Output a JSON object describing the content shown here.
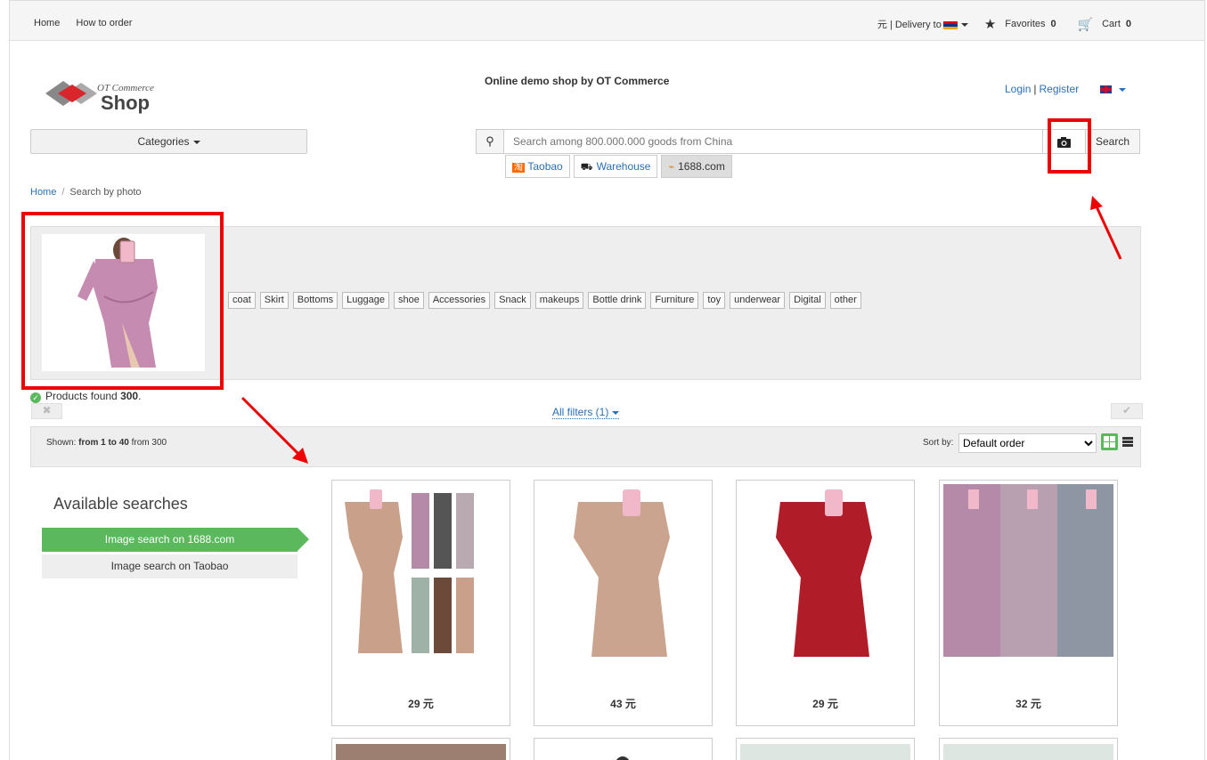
{
  "topbar": {
    "nav": [
      "Home",
      "How to order"
    ],
    "currency": "元",
    "delivery_label": "| Delivery to",
    "favorites_label": "Favorites",
    "favorites_count": "0",
    "cart_label": "Cart",
    "cart_count": "0"
  },
  "logo": {
    "small": "OT Commerce",
    "big": "Shop"
  },
  "header": {
    "tagline": "Online demo shop by OT Commerce",
    "login": "Login",
    "register": "Register",
    "categories": "Categories"
  },
  "search": {
    "placeholder": "Search among 800.000.000 goods from China",
    "button": "Search",
    "providers": [
      {
        "label": "Taobao",
        "icon": "淘",
        "active": false
      },
      {
        "label": "Warehouse",
        "icon": "⛟",
        "active": false
      },
      {
        "label": "1688.com",
        "icon": "⌁",
        "active": true
      }
    ]
  },
  "breadcrumb": {
    "home": "Home",
    "separator": "/",
    "current": "Search by photo"
  },
  "photo_tags": [
    "coat",
    "Skirt",
    "Bottoms",
    "Luggage",
    "shoe",
    "Accessories",
    "Snack",
    "makeups",
    "Bottle drink",
    "Furniture",
    "toy",
    "underwear",
    "Digital",
    "other"
  ],
  "results": {
    "found_prefix": "Products found ",
    "found_count": "300",
    "found_suffix": ".",
    "all_filters": "All filters (1)",
    "shown_prefix": "Shown: ",
    "shown_range": "from 1 to 40",
    "shown_suffix": " from 300",
    "sort_label": "Sort by:",
    "sort_value": "Default order"
  },
  "sidebar": {
    "title": "Available searches",
    "items": [
      "Image search on 1688.com",
      "Image search on Taobao"
    ]
  },
  "products": [
    {
      "price": "29 元",
      "color": "#c9a08a"
    },
    {
      "price": "43 元",
      "color": "#caa48e"
    },
    {
      "price": "29 元",
      "color": "#b01c28"
    },
    {
      "price": "32 元",
      "color": "#b48aa8"
    }
  ],
  "colors": {
    "accent_green": "#5cb85c",
    "link": "#2a6fb6",
    "highlight_red": "#e00000",
    "dress_pink": "#c58bb0"
  }
}
